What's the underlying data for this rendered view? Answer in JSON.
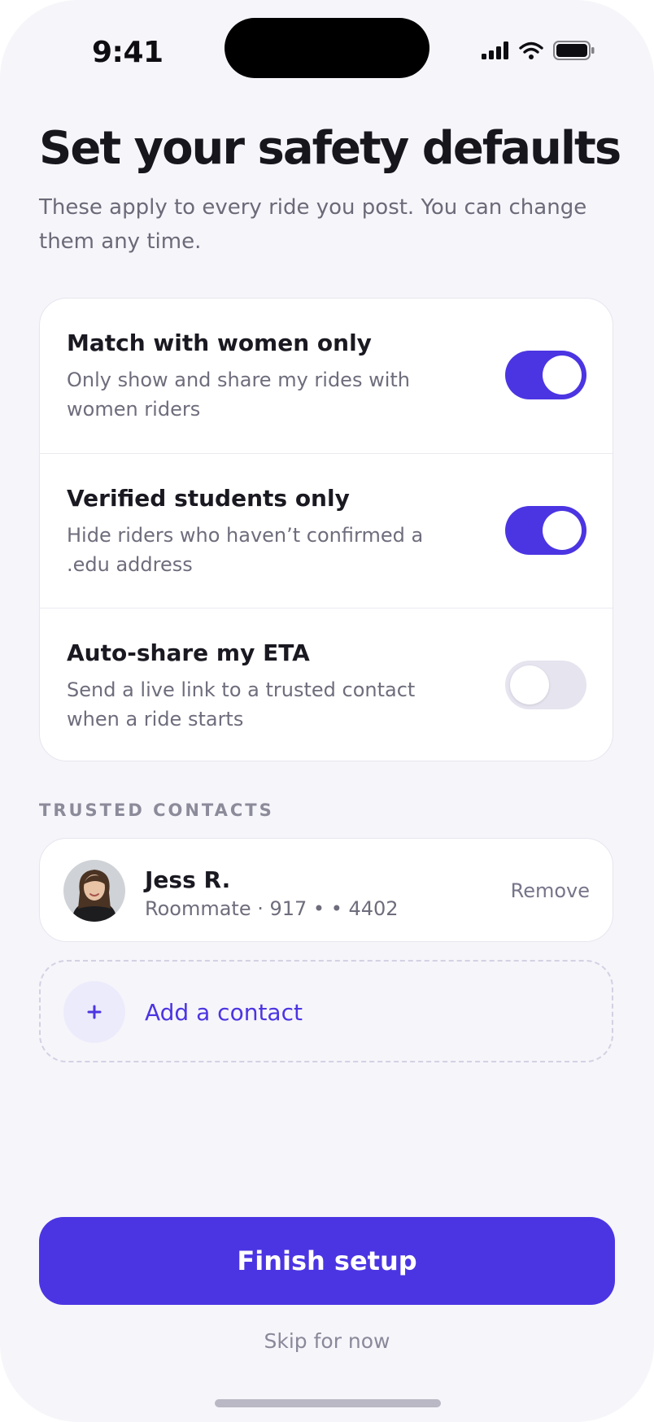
{
  "status_bar": {
    "time": "9:41",
    "icons": [
      "cellular-signal-icon",
      "wifi-icon",
      "battery-icon"
    ]
  },
  "header": {
    "title": "Set your safety defaults",
    "subtitle": "These apply to every ride you post. You can change them any time."
  },
  "settings": {
    "items": [
      {
        "title": "Match with women only",
        "description": "Only show and share my rides with women riders",
        "enabled": true
      },
      {
        "title": "Verified students only",
        "description": "Hide riders who haven’t confirmed a .edu address",
        "enabled": true
      },
      {
        "title": "Auto-share my ETA",
        "description": "Send a live link to a trusted contact when a ride starts",
        "enabled": false
      }
    ]
  },
  "trusted_contacts": {
    "section_label": "TRUSTED CONTACTS",
    "contacts": [
      {
        "name": "Jess R.",
        "detail": "Roommate · 917 • • 4402",
        "remove_label": "Remove"
      }
    ],
    "add_label": "Add a contact",
    "add_icon": "+"
  },
  "actions": {
    "finish_label": "Finish setup",
    "skip_label": "Skip for now"
  },
  "colors": {
    "accent": "#4b35e2",
    "background": "#f6f5fa",
    "toggle_off": "#e6e4ef"
  }
}
